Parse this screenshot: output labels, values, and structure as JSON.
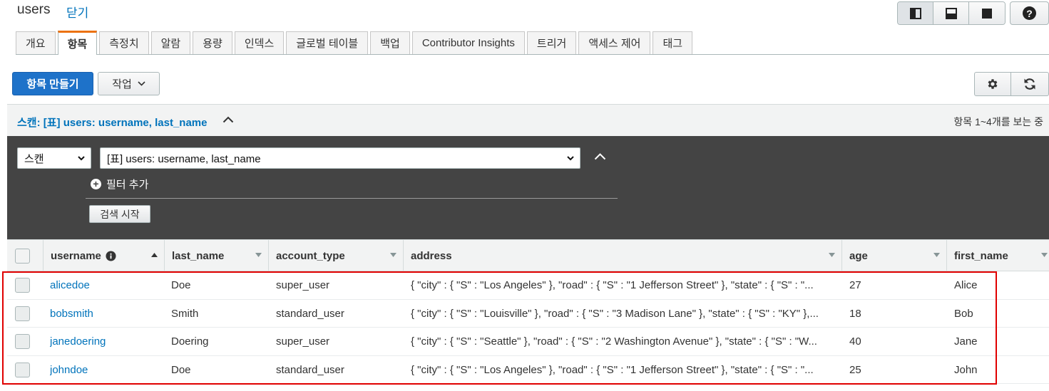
{
  "header": {
    "title": "users",
    "close_label": "닫기",
    "help_label": "?"
  },
  "tabs": [
    {
      "label": "개요"
    },
    {
      "label": "항목",
      "active": true
    },
    {
      "label": "측정치"
    },
    {
      "label": "알람"
    },
    {
      "label": "용량"
    },
    {
      "label": "인덱스"
    },
    {
      "label": "글로벌 테이블"
    },
    {
      "label": "백업"
    },
    {
      "label": "Contributor Insights"
    },
    {
      "label": "트리거"
    },
    {
      "label": "액세스 제어"
    },
    {
      "label": "태그"
    }
  ],
  "toolbar": {
    "create_item_label": "항목 만들기",
    "actions_label": "작업"
  },
  "scan": {
    "summary_title": "스캔: [표] users: username, last_name",
    "status": "항목 1~4개를 보는 중",
    "mode_value": "스캔",
    "target_value": "[표] users: username, last_name",
    "add_filter_label": "필터 추가",
    "search_button_label": "검색 시작"
  },
  "table": {
    "columns": [
      "username",
      "last_name",
      "account_type",
      "address",
      "age",
      "first_name"
    ],
    "rows": [
      {
        "username": "alicedoe",
        "last_name": "Doe",
        "account_type": "super_user",
        "address": "{ \"city\" : { \"S\" : \"Los Angeles\" }, \"road\" : { \"S\" : \"1 Jefferson Street\" }, \"state\" : { \"S\" : \"...",
        "age": "27",
        "first_name": "Alice"
      },
      {
        "username": "bobsmith",
        "last_name": "Smith",
        "account_type": "standard_user",
        "address": "{ \"city\" : { \"S\" : \"Louisville\" }, \"road\" : { \"S\" : \"3 Madison Lane\" }, \"state\" : { \"S\" : \"KY\" },...",
        "age": "18",
        "first_name": "Bob"
      },
      {
        "username": "janedoering",
        "last_name": "Doering",
        "account_type": "super_user",
        "address": "{ \"city\" : { \"S\" : \"Seattle\" }, \"road\" : { \"S\" : \"2 Washington Avenue\" }, \"state\" : { \"S\" : \"W...",
        "age": "40",
        "first_name": "Jane"
      },
      {
        "username": "johndoe",
        "last_name": "Doe",
        "account_type": "standard_user",
        "address": "{ \"city\" : { \"S\" : \"Los Angeles\" }, \"road\" : { \"S\" : \"1 Jefferson Street\" }, \"state\" : { \"S\" : \"...",
        "age": "25",
        "first_name": "John"
      }
    ]
  },
  "colors": {
    "accent": "#1e72c9",
    "link": "#0073bb",
    "tab_active": "#ec7211",
    "highlight": "#e00000"
  }
}
